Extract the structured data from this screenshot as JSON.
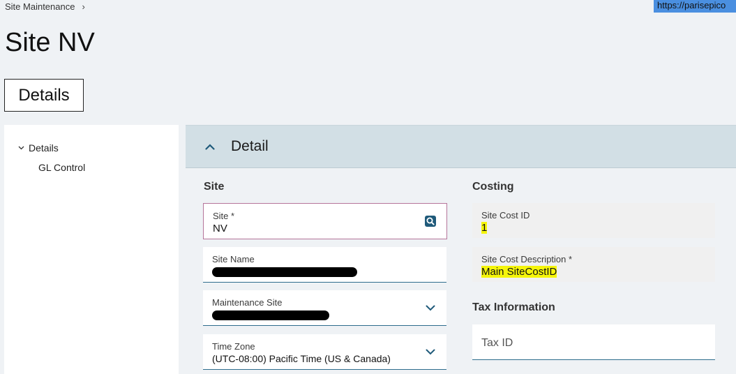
{
  "breadcrumb": {
    "item": "Site Maintenance",
    "separator": "›"
  },
  "url_tag": "https://parisepico",
  "page_title": "Site NV",
  "details_button": "Details",
  "nav": {
    "parent_label": "Details",
    "child_label": "GL Control"
  },
  "section": {
    "title": "Detail"
  },
  "site_group": {
    "label": "Site",
    "site": {
      "label": "Site *",
      "value": "NV",
      "icon": "search-icon"
    },
    "site_name": {
      "label": "Site Name",
      "value": ""
    },
    "maintenance_site": {
      "label": "Maintenance Site",
      "value": "",
      "icon": "chevron-down-icon"
    },
    "time_zone": {
      "label": "Time Zone",
      "value": "(UTC-08:00) Pacific Time (US & Canada)",
      "icon": "chevron-down-icon"
    }
  },
  "costing_group": {
    "label": "Costing",
    "site_cost_id": {
      "label": "Site Cost ID",
      "value": "1"
    },
    "site_cost_description": {
      "label": "Site Cost Description *",
      "value": "Main SiteCostID"
    }
  },
  "tax_group": {
    "label": "Tax Information",
    "tax_id": {
      "label": "Tax ID"
    }
  },
  "colors": {
    "accent": "#2d6c8c",
    "highlight": "#f5f50a",
    "focus_border": "#b5749a"
  }
}
